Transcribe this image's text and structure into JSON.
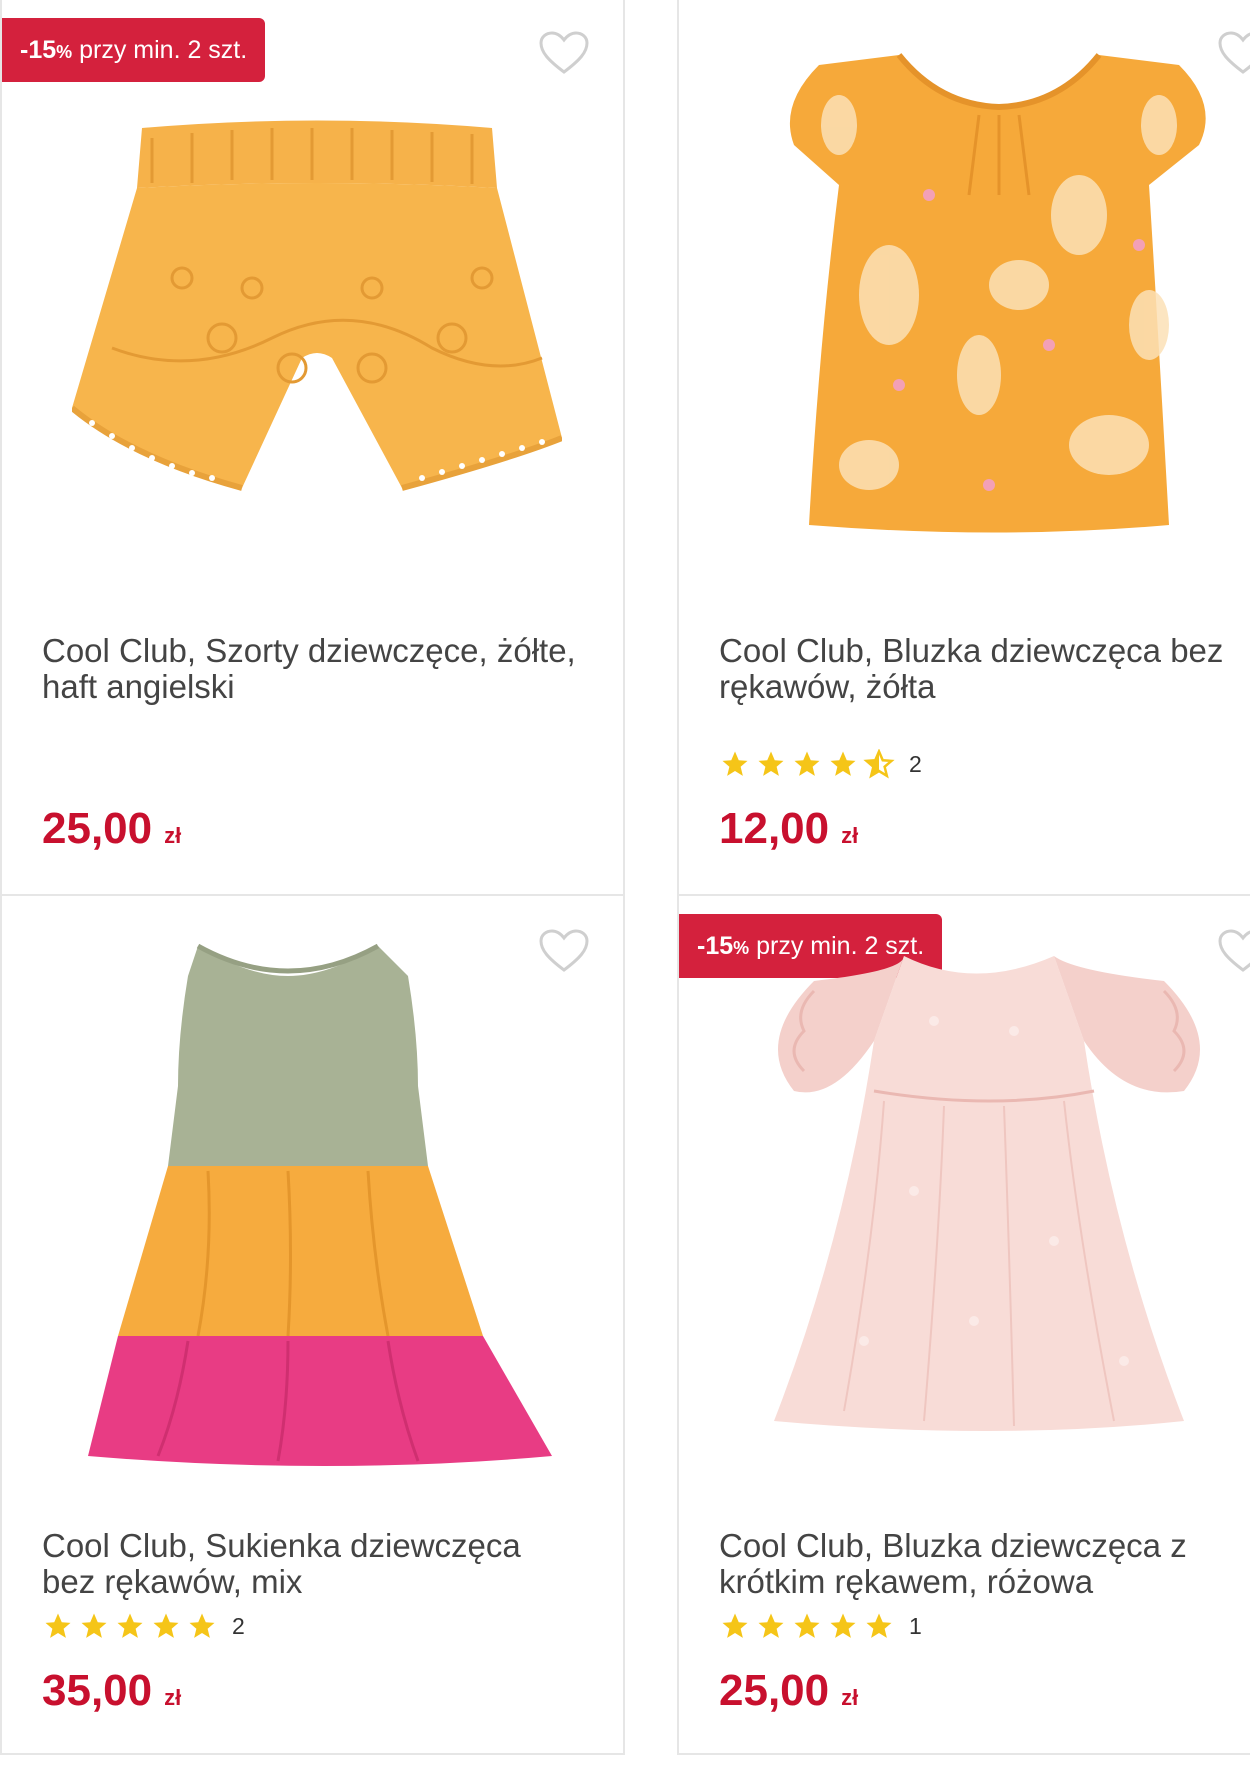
{
  "products": [
    {
      "badge_percent": "-15",
      "badge_percent_sign": "%",
      "badge_text": "przy min. 2 szt.",
      "title": "Cool Club, Szorty dziewczęce, żółte, haft angielski",
      "price": "25,00",
      "currency": "zł",
      "image_icon": "shorts-icon"
    },
    {
      "title": "Cool Club, Bluzka dziewczęca bez rękawów, żółta",
      "rating_value": 4.5,
      "rating_count": "2",
      "price": "12,00",
      "currency": "zł",
      "image_icon": "blouse-icon"
    },
    {
      "title": "Cool Club, Sukienka dziewczęca bez rękawów, mix",
      "rating_value": 5,
      "rating_count": "2",
      "price": "35,00",
      "currency": "zł",
      "image_icon": "dress-icon"
    },
    {
      "badge_percent": "-15",
      "badge_percent_sign": "%",
      "badge_text": "przy min. 2 szt.",
      "title": "Cool Club, Bluzka dziewczęca z krótkim rękawem, różowa",
      "rating_value": 5,
      "rating_count": "1",
      "price": "25,00",
      "currency": "zł",
      "image_icon": "ruffle-blouse-icon"
    }
  ],
  "colors": {
    "accent": "#d4213d",
    "price": "#c8102e",
    "star": "#f5c518",
    "border": "#e6e6e6"
  }
}
